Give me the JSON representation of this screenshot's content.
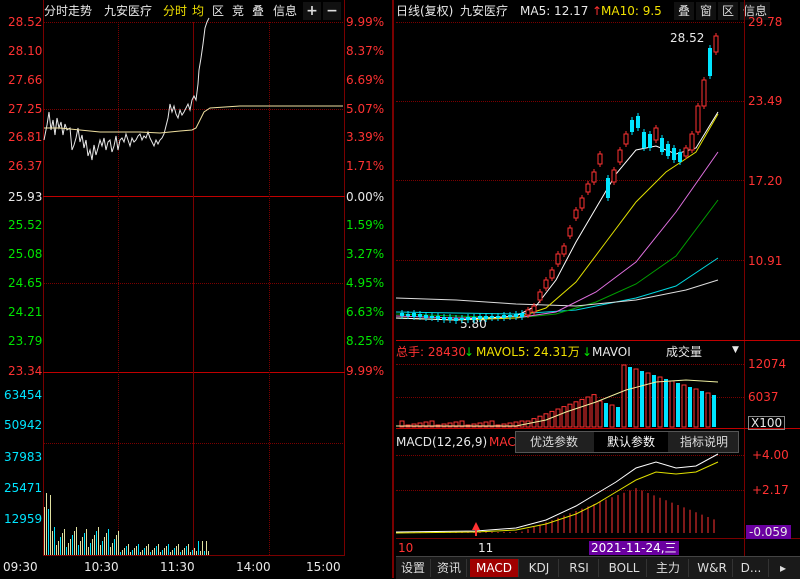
{
  "intraday": {
    "tabs": [
      "分时走势",
      "九安医疗",
      "分时",
      "均",
      "区",
      "竞",
      "叠",
      "信息",
      "+",
      "−"
    ],
    "price_axis": [
      "28.52",
      "28.10",
      "27.66",
      "27.25",
      "26.81",
      "26.37",
      "25.93",
      "25.52",
      "25.08",
      "24.65",
      "24.21",
      "23.79",
      "23.34"
    ],
    "pct_axis": [
      "9.99%",
      "8.37%",
      "6.69%",
      "5.07%",
      "3.39%",
      "1.71%",
      "0.00%",
      "1.59%",
      "3.27%",
      "4.95%",
      "6.63%",
      "8.25%",
      "9.99%"
    ],
    "vol_axis": [
      "63454",
      "50942",
      "37983",
      "25471",
      "12959"
    ],
    "time_axis": [
      "09:30",
      "10:30",
      "11:30",
      "14:00",
      "15:00"
    ]
  },
  "daily": {
    "title": "日线(复权)",
    "name": "九安医疗",
    "ma5_label": "MA5: 12.17",
    "ma10_label": "MA10: 9.5",
    "buttons": [
      "叠",
      "窗",
      "区",
      "信息"
    ],
    "price_axis": [
      "29.78",
      "23.49",
      "17.20",
      "10.91"
    ],
    "high_label": "28.52",
    "low_label": "5.80",
    "vol_header": {
      "total": "总手: 28430",
      "mavol5": "MAVOL5: 24.31万",
      "mavol_other": "MAVOI",
      "dropdown": "成交量"
    },
    "vol_axis": [
      "12074",
      "6037",
      "X100"
    ],
    "macd_header": "MACD(12,26,9)",
    "macd_short": "MAC",
    "macd_axis": [
      "+4.00",
      "+2.17"
    ],
    "macd_value": "-0.059",
    "popup": [
      "优选参数",
      "默认参数",
      "指标说明"
    ],
    "date_axis": [
      "10",
      "11"
    ],
    "cursor_date": "2021-11-24,三"
  },
  "bottom_tabs": [
    "设置",
    "资讯",
    "MACD",
    "KDJ",
    "RSI",
    "BOLL",
    "主力",
    "W&R",
    "D..."
  ],
  "active_tab": "MACD",
  "colors": {
    "up": "#ff3232",
    "down": "#00e600",
    "grid": "#7a0000",
    "accent": "#00e5ff"
  }
}
